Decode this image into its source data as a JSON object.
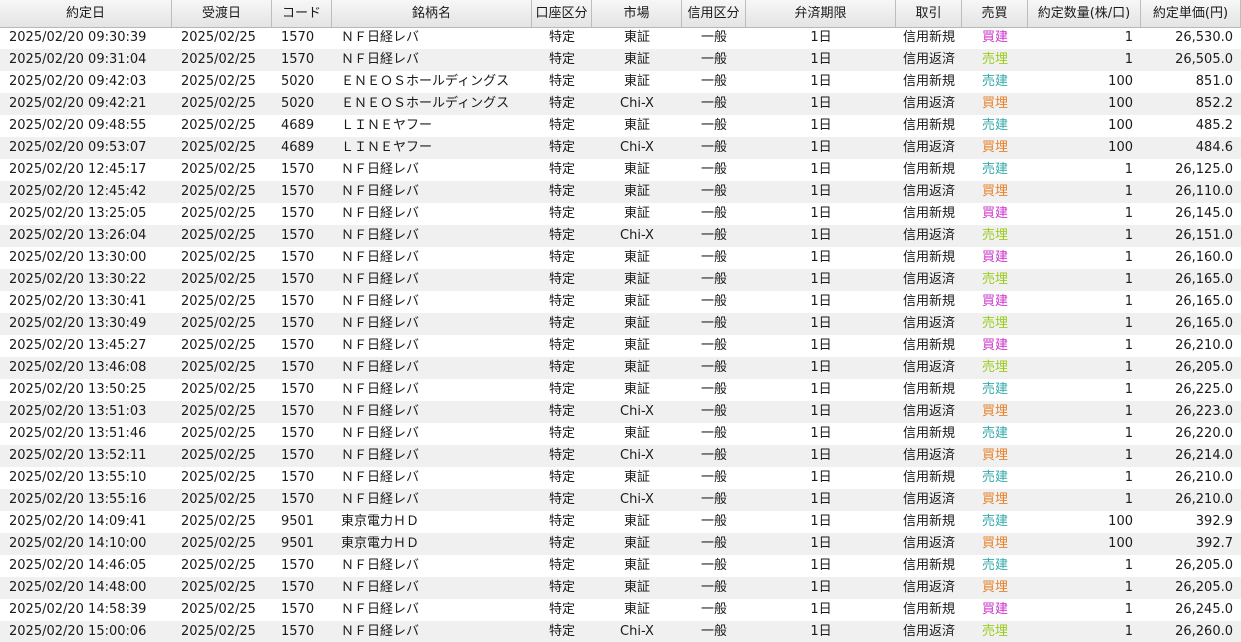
{
  "columns": [
    "約定日",
    "受渡日",
    "コード",
    "銘柄名",
    "口座区分",
    "市場",
    "信用区分",
    "弁済期限",
    "取引",
    "売買",
    "約定数量(株/口)",
    "約定単価(円)"
  ],
  "side_colors": {
    "買建": "#cc33cc",
    "売建": "#33aaaa",
    "買埋": "#e8822a",
    "売埋": "#9acd1a"
  },
  "rows": [
    [
      "2025/02/20 09:30:39",
      "2025/02/25",
      "1570",
      "ＮＦ日経レバ",
      "特定",
      "東証",
      "一般",
      "1日",
      "信用新規",
      "買建",
      "1",
      "26,530.0"
    ],
    [
      "2025/02/20 09:31:04",
      "2025/02/25",
      "1570",
      "ＮＦ日経レバ",
      "特定",
      "東証",
      "一般",
      "1日",
      "信用返済",
      "売埋",
      "1",
      "26,505.0"
    ],
    [
      "2025/02/20 09:42:03",
      "2025/02/25",
      "5020",
      "ＥＮＥＯＳホールディングス",
      "特定",
      "東証",
      "一般",
      "1日",
      "信用新規",
      "売建",
      "100",
      "851.0"
    ],
    [
      "2025/02/20 09:42:21",
      "2025/02/25",
      "5020",
      "ＥＮＥＯＳホールディングス",
      "特定",
      "Chi-X",
      "一般",
      "1日",
      "信用返済",
      "買埋",
      "100",
      "852.2"
    ],
    [
      "2025/02/20 09:48:55",
      "2025/02/25",
      "4689",
      "ＬＩＮＥヤフー",
      "特定",
      "東証",
      "一般",
      "1日",
      "信用新規",
      "売建",
      "100",
      "485.2"
    ],
    [
      "2025/02/20 09:53:07",
      "2025/02/25",
      "4689",
      "ＬＩＮＥヤフー",
      "特定",
      "Chi-X",
      "一般",
      "1日",
      "信用返済",
      "買埋",
      "100",
      "484.6"
    ],
    [
      "2025/02/20 12:45:17",
      "2025/02/25",
      "1570",
      "ＮＦ日経レバ",
      "特定",
      "東証",
      "一般",
      "1日",
      "信用新規",
      "売建",
      "1",
      "26,125.0"
    ],
    [
      "2025/02/20 12:45:42",
      "2025/02/25",
      "1570",
      "ＮＦ日経レバ",
      "特定",
      "東証",
      "一般",
      "1日",
      "信用返済",
      "買埋",
      "1",
      "26,110.0"
    ],
    [
      "2025/02/20 13:25:05",
      "2025/02/25",
      "1570",
      "ＮＦ日経レバ",
      "特定",
      "東証",
      "一般",
      "1日",
      "信用新規",
      "買建",
      "1",
      "26,145.0"
    ],
    [
      "2025/02/20 13:26:04",
      "2025/02/25",
      "1570",
      "ＮＦ日経レバ",
      "特定",
      "Chi-X",
      "一般",
      "1日",
      "信用返済",
      "売埋",
      "1",
      "26,151.0"
    ],
    [
      "2025/02/20 13:30:00",
      "2025/02/25",
      "1570",
      "ＮＦ日経レバ",
      "特定",
      "東証",
      "一般",
      "1日",
      "信用新規",
      "買建",
      "1",
      "26,160.0"
    ],
    [
      "2025/02/20 13:30:22",
      "2025/02/25",
      "1570",
      "ＮＦ日経レバ",
      "特定",
      "東証",
      "一般",
      "1日",
      "信用返済",
      "売埋",
      "1",
      "26,165.0"
    ],
    [
      "2025/02/20 13:30:41",
      "2025/02/25",
      "1570",
      "ＮＦ日経レバ",
      "特定",
      "東証",
      "一般",
      "1日",
      "信用新規",
      "買建",
      "1",
      "26,165.0"
    ],
    [
      "2025/02/20 13:30:49",
      "2025/02/25",
      "1570",
      "ＮＦ日経レバ",
      "特定",
      "東証",
      "一般",
      "1日",
      "信用返済",
      "売埋",
      "1",
      "26,165.0"
    ],
    [
      "2025/02/20 13:45:27",
      "2025/02/25",
      "1570",
      "ＮＦ日経レバ",
      "特定",
      "東証",
      "一般",
      "1日",
      "信用新規",
      "買建",
      "1",
      "26,210.0"
    ],
    [
      "2025/02/20 13:46:08",
      "2025/02/25",
      "1570",
      "ＮＦ日経レバ",
      "特定",
      "東証",
      "一般",
      "1日",
      "信用返済",
      "売埋",
      "1",
      "26,205.0"
    ],
    [
      "2025/02/20 13:50:25",
      "2025/02/25",
      "1570",
      "ＮＦ日経レバ",
      "特定",
      "東証",
      "一般",
      "1日",
      "信用新規",
      "売建",
      "1",
      "26,225.0"
    ],
    [
      "2025/02/20 13:51:03",
      "2025/02/25",
      "1570",
      "ＮＦ日経レバ",
      "特定",
      "Chi-X",
      "一般",
      "1日",
      "信用返済",
      "買埋",
      "1",
      "26,223.0"
    ],
    [
      "2025/02/20 13:51:46",
      "2025/02/25",
      "1570",
      "ＮＦ日経レバ",
      "特定",
      "東証",
      "一般",
      "1日",
      "信用新規",
      "売建",
      "1",
      "26,220.0"
    ],
    [
      "2025/02/20 13:52:11",
      "2025/02/25",
      "1570",
      "ＮＦ日経レバ",
      "特定",
      "Chi-X",
      "一般",
      "1日",
      "信用返済",
      "買埋",
      "1",
      "26,214.0"
    ],
    [
      "2025/02/20 13:55:10",
      "2025/02/25",
      "1570",
      "ＮＦ日経レバ",
      "特定",
      "東証",
      "一般",
      "1日",
      "信用新規",
      "売建",
      "1",
      "26,210.0"
    ],
    [
      "2025/02/20 13:55:16",
      "2025/02/25",
      "1570",
      "ＮＦ日経レバ",
      "特定",
      "Chi-X",
      "一般",
      "1日",
      "信用返済",
      "買埋",
      "1",
      "26,210.0"
    ],
    [
      "2025/02/20 14:09:41",
      "2025/02/25",
      "9501",
      "東京電力ＨＤ",
      "特定",
      "東証",
      "一般",
      "1日",
      "信用新規",
      "売建",
      "100",
      "392.9"
    ],
    [
      "2025/02/20 14:10:00",
      "2025/02/25",
      "9501",
      "東京電力ＨＤ",
      "特定",
      "東証",
      "一般",
      "1日",
      "信用返済",
      "買埋",
      "100",
      "392.7"
    ],
    [
      "2025/02/20 14:46:05",
      "2025/02/25",
      "1570",
      "ＮＦ日経レバ",
      "特定",
      "東証",
      "一般",
      "1日",
      "信用新規",
      "売建",
      "1",
      "26,205.0"
    ],
    [
      "2025/02/20 14:48:00",
      "2025/02/25",
      "1570",
      "ＮＦ日経レバ",
      "特定",
      "東証",
      "一般",
      "1日",
      "信用返済",
      "買埋",
      "1",
      "26,205.0"
    ],
    [
      "2025/02/20 14:58:39",
      "2025/02/25",
      "1570",
      "ＮＦ日経レバ",
      "特定",
      "東証",
      "一般",
      "1日",
      "信用新規",
      "買建",
      "1",
      "26,245.0"
    ],
    [
      "2025/02/20 15:00:06",
      "2025/02/25",
      "1570",
      "ＮＦ日経レバ",
      "特定",
      "Chi-X",
      "一般",
      "1日",
      "信用返済",
      "売埋",
      "1",
      "26,260.0"
    ]
  ]
}
